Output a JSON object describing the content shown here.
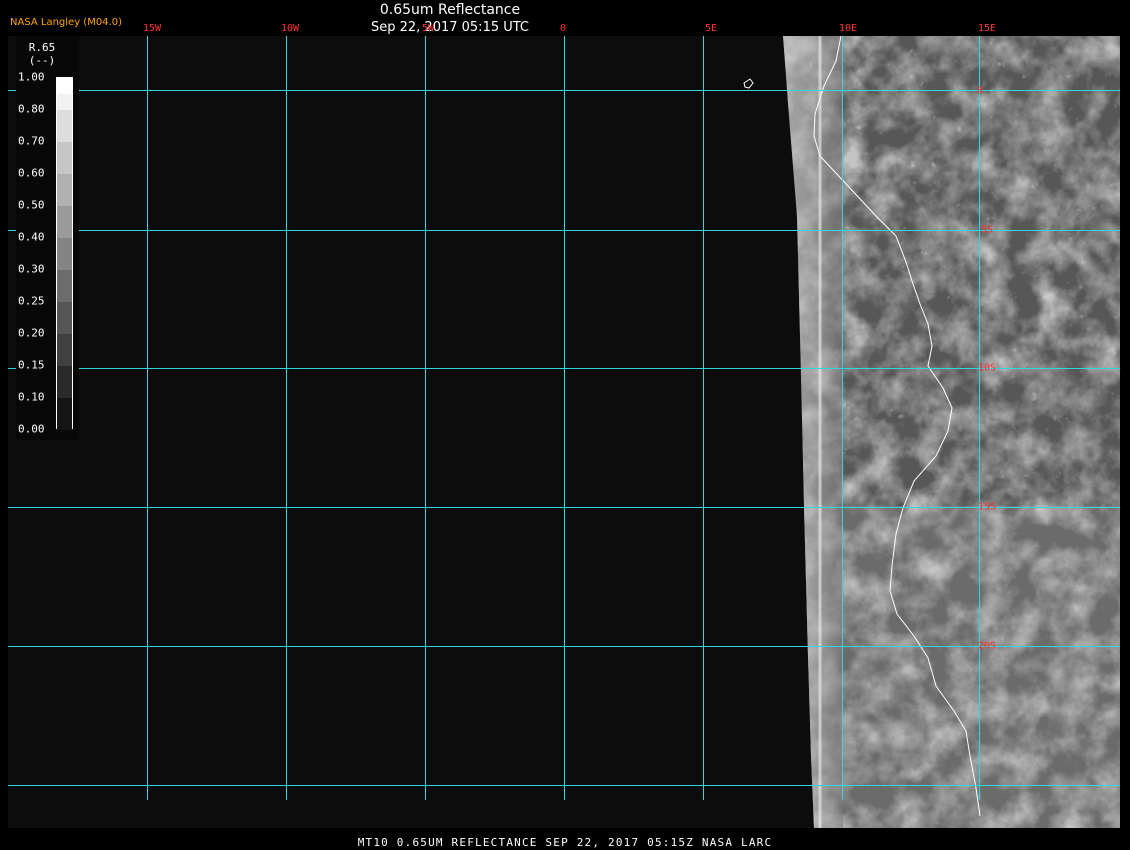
{
  "header": {
    "brand": "NASA Langley (M04.0)",
    "title": "0.65um Reflectance",
    "subtitle": "Sep 22, 2017 05:15 UTC"
  },
  "colors": {
    "grid": "#33d6e0",
    "coastline": "#ffffff",
    "lat_lon_label": "#ff3030",
    "brand": "#ffa500",
    "background": "#0c0c0c"
  },
  "grid": {
    "lon_labels": [
      "15W",
      "10W",
      "5W",
      "0",
      "5E",
      "10E",
      "15E"
    ],
    "lat_labels": [
      "0",
      "5S",
      "10S",
      "15S",
      "20S"
    ]
  },
  "legend": {
    "title": "R.65",
    "unit": "(--)",
    "ticks": [
      "1.00",
      "0.80",
      "0.70",
      "0.60",
      "0.50",
      "0.40",
      "0.30",
      "0.25",
      "0.20",
      "0.15",
      "0.10",
      "0.00"
    ]
  },
  "footer": "MT10  0.65UM REFLECTANCE   SEP 22, 2017 05:15Z   NASA LARC"
}
